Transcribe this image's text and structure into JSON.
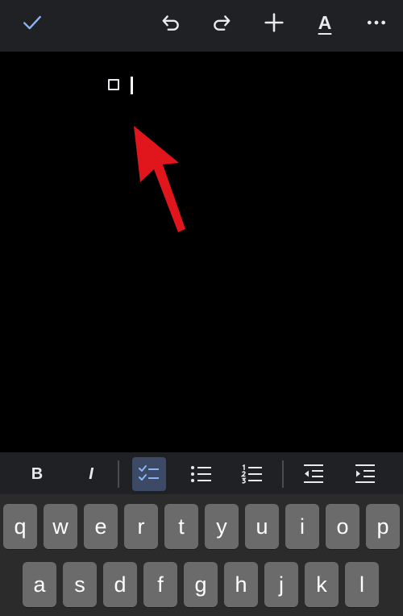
{
  "toolbar": {
    "done_icon": "check-icon",
    "undo_icon": "undo-icon",
    "redo_icon": "redo-icon",
    "insert_icon": "plus-icon",
    "text_format_icon": "text-format-icon",
    "text_format_label": "A",
    "more_icon": "more-horizontal-icon",
    "accent_color": "#8ab4f8"
  },
  "format_bar": {
    "bold_label": "B",
    "italic_label": "I",
    "checklist_icon": "checklist-icon",
    "checklist_active": true,
    "bullet_list_icon": "bulleted-list-icon",
    "numbered_list_icon": "numbered-list-icon",
    "decrease_indent_icon": "decrease-indent-icon",
    "increase_indent_icon": "increase-indent-icon"
  },
  "keyboard": {
    "row1": [
      "q",
      "w",
      "e",
      "r",
      "t",
      "y",
      "u",
      "i",
      "o",
      "p"
    ],
    "row2": [
      "a",
      "s",
      "d",
      "f",
      "g",
      "h",
      "j",
      "k",
      "l"
    ]
  },
  "annotation": {
    "arrow_color": "#e0161c"
  }
}
